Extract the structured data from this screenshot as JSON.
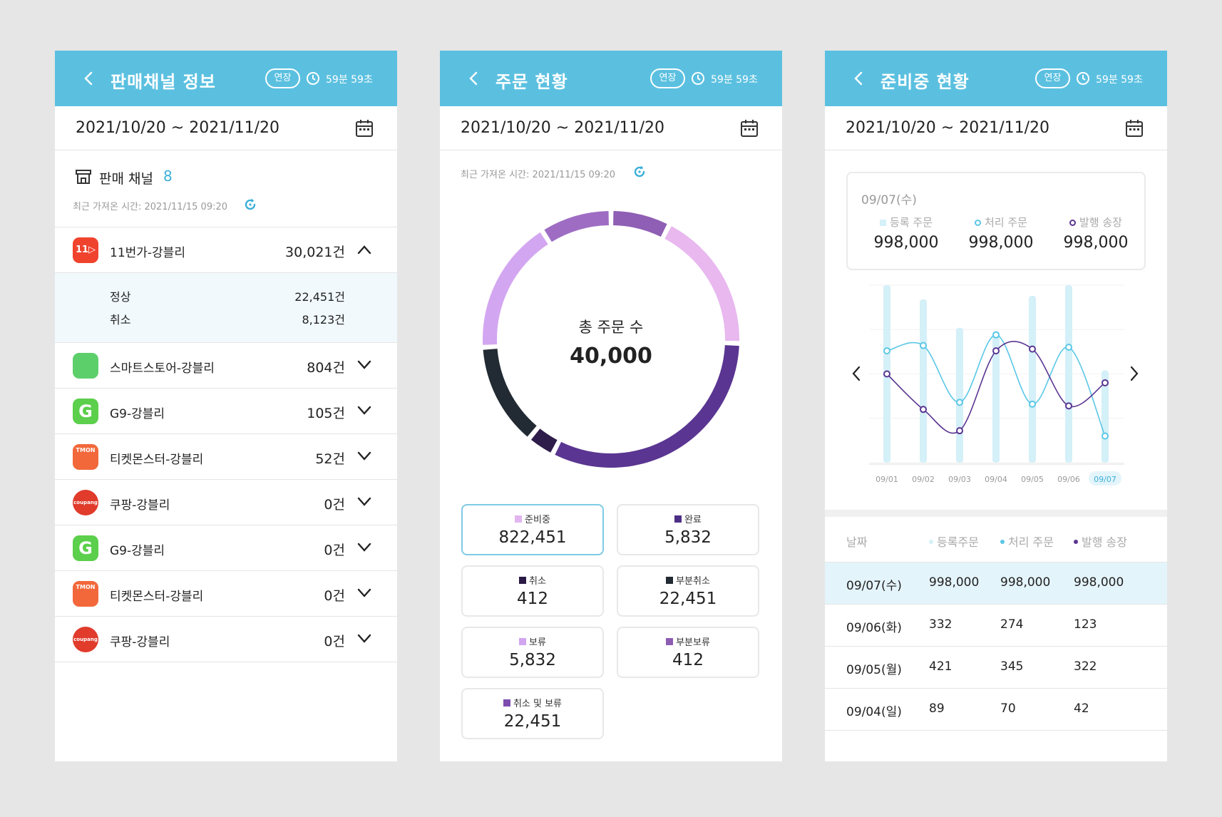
{
  "common": {
    "extend_label": "연장",
    "timer": "59분 59초",
    "date_range": "2021/10/20 ~ 2021/11/20"
  },
  "panel1": {
    "title": "판매채널 정보",
    "section_title": "판매 채널",
    "section_count": "8",
    "fetched": "최근 가져온 시간: 2021/11/15 09:20",
    "channels": [
      {
        "name": "11번가-강블리",
        "count": "30,021건",
        "logo": "11st",
        "logo_text": "11▷",
        "expanded": true
      },
      {
        "name": "스마트스토어-강블리",
        "count": "804건",
        "logo": "smartstore",
        "logo_text": ""
      },
      {
        "name": "G9-강블리",
        "count": "105건",
        "logo": "g9",
        "logo_text": "G"
      },
      {
        "name": "티켓몬스터-강블리",
        "count": "52건",
        "logo": "tmon",
        "logo_text": "TMON"
      },
      {
        "name": "쿠팡-강블리",
        "count": "0건",
        "logo": "coupang",
        "logo_text": "coupang"
      },
      {
        "name": "G9-강블리",
        "count": "0건",
        "logo": "g9",
        "logo_text": "G"
      },
      {
        "name": "티켓몬스터-강블리",
        "count": "0건",
        "logo": "tmon",
        "logo_text": "TMON"
      },
      {
        "name": "쿠팡-강블리",
        "count": "0건",
        "logo": "coupang",
        "logo_text": "coupang"
      }
    ],
    "sub": [
      {
        "label": "정상",
        "value": "22,451건"
      },
      {
        "label": "취소",
        "value": "8,123건"
      }
    ]
  },
  "panel2": {
    "title": "주문 현황",
    "fetched": "최근 가져온 시간: 2021/11/15 09:20",
    "donut_title": "총 주문 수",
    "donut_total": "40,000",
    "segments": [
      {
        "color": "#8e5fb4",
        "fraction": 0.075
      },
      {
        "color": "#e8b8ef",
        "fraction": 0.18
      },
      {
        "color": "#5a3591",
        "fraction": 0.32
      },
      {
        "color": "#2e1c4a",
        "fraction": 0.035
      },
      {
        "color": "#222a33",
        "fraction": 0.13
      },
      {
        "color": "#d3a6f1",
        "fraction": 0.17
      },
      {
        "color": "#9e6dc3",
        "fraction": 0.09
      }
    ],
    "cards": [
      {
        "label": "준비중",
        "value": "822,451",
        "color": "#e2b5f0",
        "active": true
      },
      {
        "label": "완료",
        "value": "5,832",
        "color": "#4d2e85"
      },
      {
        "label": "취소",
        "value": "412",
        "color": "#2b1a45"
      },
      {
        "label": "부분취소",
        "value": "22,451",
        "color": "#222a33"
      },
      {
        "label": "보류",
        "value": "5,832",
        "color": "#d1a5f0"
      },
      {
        "label": "부분보류",
        "value": "412",
        "color": "#8d5cb3"
      },
      {
        "label": "취소 및 보류",
        "value": "22,451",
        "color": "#7e4db0"
      }
    ]
  },
  "panel3": {
    "title": "준비중 현황",
    "summary": {
      "date": "09/07(수)",
      "cols": [
        {
          "label": "등록 주문",
          "value": "998,000"
        },
        {
          "label": "처리 주문",
          "value": "998,000"
        },
        {
          "label": "발행 송장",
          "value": "998,000"
        }
      ]
    },
    "table": {
      "headers": [
        "날짜",
        "등록주문",
        "처리 주문",
        "발행 송장"
      ],
      "rows": [
        [
          "09/07(수)",
          "998,000",
          "998,000",
          "998,000"
        ],
        [
          "09/06(화)",
          "332",
          "274",
          "123"
        ],
        [
          "09/05(월)",
          "421",
          "345",
          "322"
        ],
        [
          "09/04(일)",
          "89",
          "70",
          "42"
        ]
      ]
    }
  },
  "chart_data": {
    "type": "line",
    "x": [
      "09/01",
      "09/02",
      "09/03",
      "09/04",
      "09/05",
      "09/06",
      "09/07"
    ],
    "highlight_x": "09/07",
    "ylim": [
      0,
      1
    ],
    "series": [
      {
        "name": "등록 주문",
        "kind": "bar",
        "color": "#d4f0f8",
        "values": [
          1.0,
          0.92,
          0.76,
          0.74,
          0.94,
          1.0,
          0.52
        ]
      },
      {
        "name": "처리 주문",
        "kind": "line",
        "color": "#5bc7e6",
        "values": [
          0.63,
          0.66,
          0.34,
          0.72,
          0.33,
          0.65,
          0.15
        ]
      },
      {
        "name": "발행 송장",
        "kind": "line",
        "color": "#5a3591",
        "values": [
          0.5,
          0.3,
          0.18,
          0.63,
          0.64,
          0.32,
          0.45
        ]
      }
    ]
  }
}
